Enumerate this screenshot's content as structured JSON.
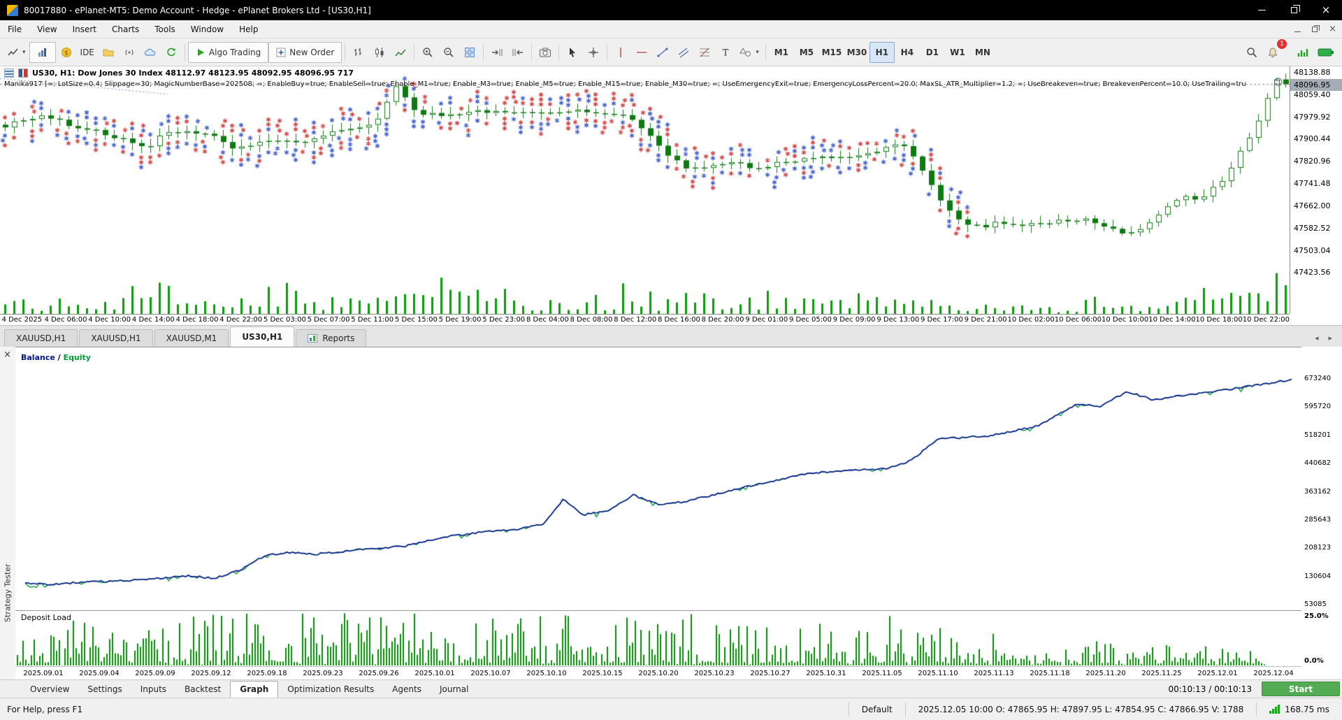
{
  "window": {
    "title": "80017880 - ePlanet-MT5: Demo Account - Hedge - ePlanet Brokers Ltd - [US30,H1]"
  },
  "menu": {
    "items": [
      "File",
      "View",
      "Insert",
      "Charts",
      "Tools",
      "Window",
      "Help"
    ]
  },
  "toolbar": {
    "ide_label": "IDE",
    "algo_trading_label": "Algo Trading",
    "new_order_label": "New Order",
    "timeframes": [
      "M1",
      "M5",
      "M15",
      "M30",
      "H1",
      "H4",
      "D1",
      "W1",
      "MN"
    ],
    "active_timeframe": "H1",
    "notification_count": "1"
  },
  "chart": {
    "symbol_info": "US30, H1:  Dow Jones 30 Index  48112.97 48123.95 48092.95 48096.95  717",
    "ea_settings": "Manika917 [=; LotSize=0.4; Slippage=30; MagicNumberBase=202508; =; EnableBuy=true; EnableSell=true; Enable_M1=true; Enable_M3=true; Enable_M5=true; Enable_M15=true; Enable_M30=true; =; UseEmergencyExit=true; EmergencyLossPercent=20.0; MaxSL_ATR_Multiplier=1.2; =; UseBreakeven=true; BreakevenPercent=10.0; UseTrailing=tru",
    "current_price": "48096.95",
    "price_labels": [
      "48138.88",
      "48059.40",
      "47979.92",
      "47900.44",
      "47820.96",
      "47741.48",
      "47662.00",
      "47582.52",
      "47503.04",
      "47423.56"
    ],
    "time_labels": [
      "4 Dec 2025",
      "4 Dec 06:00",
      "4 Dec 10:00",
      "4 Dec 14:00",
      "4 Dec 18:00",
      "4 Dec 22:00",
      "5 Dec 03:00",
      "5 Dec 07:00",
      "5 Dec 11:00",
      "5 Dec 15:00",
      "5 Dec 19:00",
      "5 Dec 23:00",
      "8 Dec 04:00",
      "8 Dec 08:00",
      "8 Dec 12:00",
      "8 Dec 16:00",
      "8 Dec 20:00",
      "9 Dec 01:00",
      "9 Dec 05:00",
      "9 Dec 09:00",
      "9 Dec 13:00",
      "9 Dec 17:00",
      "9 Dec 21:00",
      "10 Dec 02:00",
      "10 Dec 06:00",
      "10 Dec 10:00",
      "10 Dec 14:00",
      "10 Dec 18:00",
      "10 Dec 22:00"
    ]
  },
  "chart_tabs": {
    "tabs": [
      {
        "label": "XAUUSD,H1",
        "active": false
      },
      {
        "label": "XAUUSD,H1",
        "active": false
      },
      {
        "label": "XAUUSD,M1",
        "active": false
      },
      {
        "label": "US30,H1",
        "active": true
      },
      {
        "label": "Reports",
        "active": false,
        "icon": "reports"
      }
    ]
  },
  "tester": {
    "panel_label": "Strategy Tester",
    "legend": {
      "balance": "Balance",
      "separator": " / ",
      "equity": "Equity"
    },
    "y_labels": [
      "673240",
      "595720",
      "518201",
      "440682",
      "363162",
      "285643",
      "208123",
      "130604",
      "53085"
    ],
    "deposit_label": "Deposit Load",
    "deposit_max": "25.0%",
    "deposit_min": "0.0%",
    "x_labels": [
      "2025.09.01",
      "2025.09.04",
      "2025.09.09",
      "2025.09.12",
      "2025.09.18",
      "2025.09.23",
      "2025.09.26",
      "2025.10.01",
      "2025.10.07",
      "2025.10.10",
      "2025.10.15",
      "2025.10.20",
      "2025.10.23",
      "2025.10.27",
      "2025.10.31",
      "2025.11.05",
      "2025.11.10",
      "2025.11.13",
      "2025.11.18",
      "2025.11.20",
      "2025.11.25",
      "2025.12.01",
      "2025.12.04"
    ],
    "tabs": [
      "Overview",
      "Settings",
      "Inputs",
      "Backtest",
      "Graph",
      "Optimization Results",
      "Agents",
      "Journal"
    ],
    "active_tab": "Graph",
    "time_display": "00:10:13 / 00:10:13",
    "start_label": "Start"
  },
  "status_bar": {
    "help": "For Help, press F1",
    "profile": "Default",
    "ohlc": "2025.12.05 10:00  O: 47865.95  H: 47897.95  L: 47854.95  C: 47866.95  V: 1788",
    "latency": "168.75 ms"
  },
  "icons": {
    "close_x": "×",
    "tab_left": "◂",
    "tab_right": "▸",
    "ea_smiley": "☺",
    "caret_down": "▾"
  },
  "colors": {
    "algo_green": "#1fa51f",
    "start_button": "#53ab53",
    "balance_line": "#00148c",
    "equity_line": "#009933",
    "marker_red": "#d03a3a",
    "marker_blue": "#3a57c9",
    "candle_green": "#0e7a12",
    "volume_green": "#0a9b0a",
    "deposit_green": "#068a06",
    "badge_red": "#e03030",
    "price_tag_bg": "#a4adb5"
  },
  "chart_data": [
    {
      "type": "candlestick",
      "title": "US30,H1: Dow Jones 30 Index",
      "ylim": [
        47423.56,
        48138.88
      ],
      "x_range": [
        "4 Dec 2025",
        "10 Dec 22:00"
      ],
      "last_close": 48096.95,
      "approx_close_anchors": [
        [
          0,
          47950
        ],
        [
          0.03,
          47985
        ],
        [
          0.06,
          47940
        ],
        [
          0.09,
          47905
        ],
        [
          0.11,
          47865
        ],
        [
          0.125,
          47930
        ],
        [
          0.16,
          47915
        ],
        [
          0.18,
          47865
        ],
        [
          0.2,
          47895
        ],
        [
          0.23,
          47885
        ],
        [
          0.26,
          47930
        ],
        [
          0.29,
          47965
        ],
        [
          0.305,
          48085
        ],
        [
          0.32,
          47995
        ],
        [
          0.35,
          47985
        ],
        [
          0.38,
          48005
        ],
        [
          0.41,
          47990
        ],
        [
          0.44,
          48000
        ],
        [
          0.47,
          47995
        ],
        [
          0.49,
          47975
        ],
        [
          0.505,
          47905
        ],
        [
          0.52,
          47835
        ],
        [
          0.535,
          47795
        ],
        [
          0.55,
          47805
        ],
        [
          0.57,
          47815
        ],
        [
          0.59,
          47795
        ],
        [
          0.61,
          47825
        ],
        [
          0.63,
          47835
        ],
        [
          0.65,
          47830
        ],
        [
          0.67,
          47845
        ],
        [
          0.685,
          47865
        ],
        [
          0.7,
          47895
        ],
        [
          0.715,
          47805
        ],
        [
          0.73,
          47685
        ],
        [
          0.745,
          47615
        ],
        [
          0.76,
          47585
        ],
        [
          0.78,
          47605
        ],
        [
          0.8,
          47595
        ],
        [
          0.82,
          47605
        ],
        [
          0.84,
          47615
        ],
        [
          0.86,
          47595
        ],
        [
          0.875,
          47565
        ],
        [
          0.89,
          47585
        ],
        [
          0.905,
          47645
        ],
        [
          0.92,
          47705
        ],
        [
          0.935,
          47685
        ],
        [
          0.95,
          47755
        ],
        [
          0.965,
          47855
        ],
        [
          0.98,
          47985
        ],
        [
          0.992,
          48125
        ],
        [
          1,
          48097
        ]
      ]
    },
    {
      "type": "line",
      "title": "Balance / Equity",
      "ylim": [
        53085,
        673240
      ],
      "x_range": [
        "2025.09.01",
        "2025.12.04"
      ],
      "series": [
        {
          "name": "Balance",
          "points": [
            [
              0,
              113000
            ],
            [
              0.02,
              111000
            ],
            [
              0.05,
              118000
            ],
            [
              0.08,
              121000
            ],
            [
              0.1,
              127000
            ],
            [
              0.13,
              134000
            ],
            [
              0.15,
              128000
            ],
            [
              0.17,
              150000
            ],
            [
              0.19,
              192000
            ],
            [
              0.21,
              198000
            ],
            [
              0.23,
              194000
            ],
            [
              0.26,
              205000
            ],
            [
              0.3,
              216000
            ],
            [
              0.33,
              240000
            ],
            [
              0.36,
              255000
            ],
            [
              0.39,
              262000
            ],
            [
              0.41,
              278000
            ],
            [
              0.425,
              345000
            ],
            [
              0.44,
              302000
            ],
            [
              0.46,
              312000
            ],
            [
              0.48,
              356000
            ],
            [
              0.5,
              330000
            ],
            [
              0.52,
              338000
            ],
            [
              0.55,
              362000
            ],
            [
              0.58,
              388000
            ],
            [
              0.62,
              416000
            ],
            [
              0.65,
              424000
            ],
            [
              0.68,
              428000
            ],
            [
              0.7,
              452000
            ],
            [
              0.72,
              510000
            ],
            [
              0.76,
              518000
            ],
            [
              0.8,
              546000
            ],
            [
              0.83,
              605000
            ],
            [
              0.85,
              600000
            ],
            [
              0.87,
              641000
            ],
            [
              0.89,
              618000
            ],
            [
              0.92,
              632000
            ],
            [
              0.95,
              646000
            ],
            [
              0.97,
              657000
            ],
            [
              1,
              673240
            ]
          ]
        }
      ]
    },
    {
      "type": "bar",
      "title": "Deposit Load",
      "ylim_pct": [
        0,
        25
      ]
    }
  ]
}
